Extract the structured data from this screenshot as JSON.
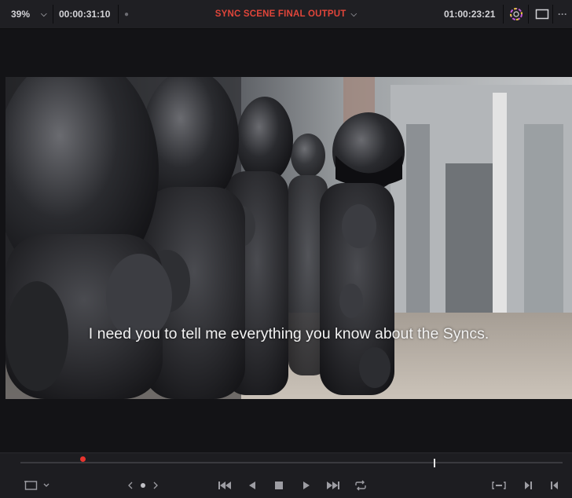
{
  "header": {
    "zoom": "39%",
    "source_timecode": "00:00:31:10",
    "title": "SYNC SCENE FINAL OUTPUT",
    "record_timecode": "01:00:23:21"
  },
  "viewer": {
    "subtitle": "I need you to tell me everything you know about the Syncs."
  },
  "icons": {
    "zoom_dropdown": "chevron-down-icon",
    "title_dropdown": "chevron-down-icon",
    "scopes": "color-wheel-icon",
    "view_mode": "single-viewer-icon",
    "more": "ellipsis-icon",
    "safe_area": "viewer-overlay-icon",
    "jog": "jog-shuttle-icon",
    "go_to_start": "skip-to-start-icon",
    "play_reverse": "play-reverse-icon",
    "stop": "stop-icon",
    "play": "play-icon",
    "go_to_end": "skip-to-end-icon",
    "loop": "loop-icon",
    "match_frame": "match-frame-icon",
    "next_edit": "next-edit-icon",
    "prev_edit": "prev-edit-icon"
  },
  "colors": {
    "title": "#e0453a",
    "playhead": "#e8342e"
  },
  "playback": {
    "playhead_position": 0.115,
    "mark_position": 0.762
  }
}
